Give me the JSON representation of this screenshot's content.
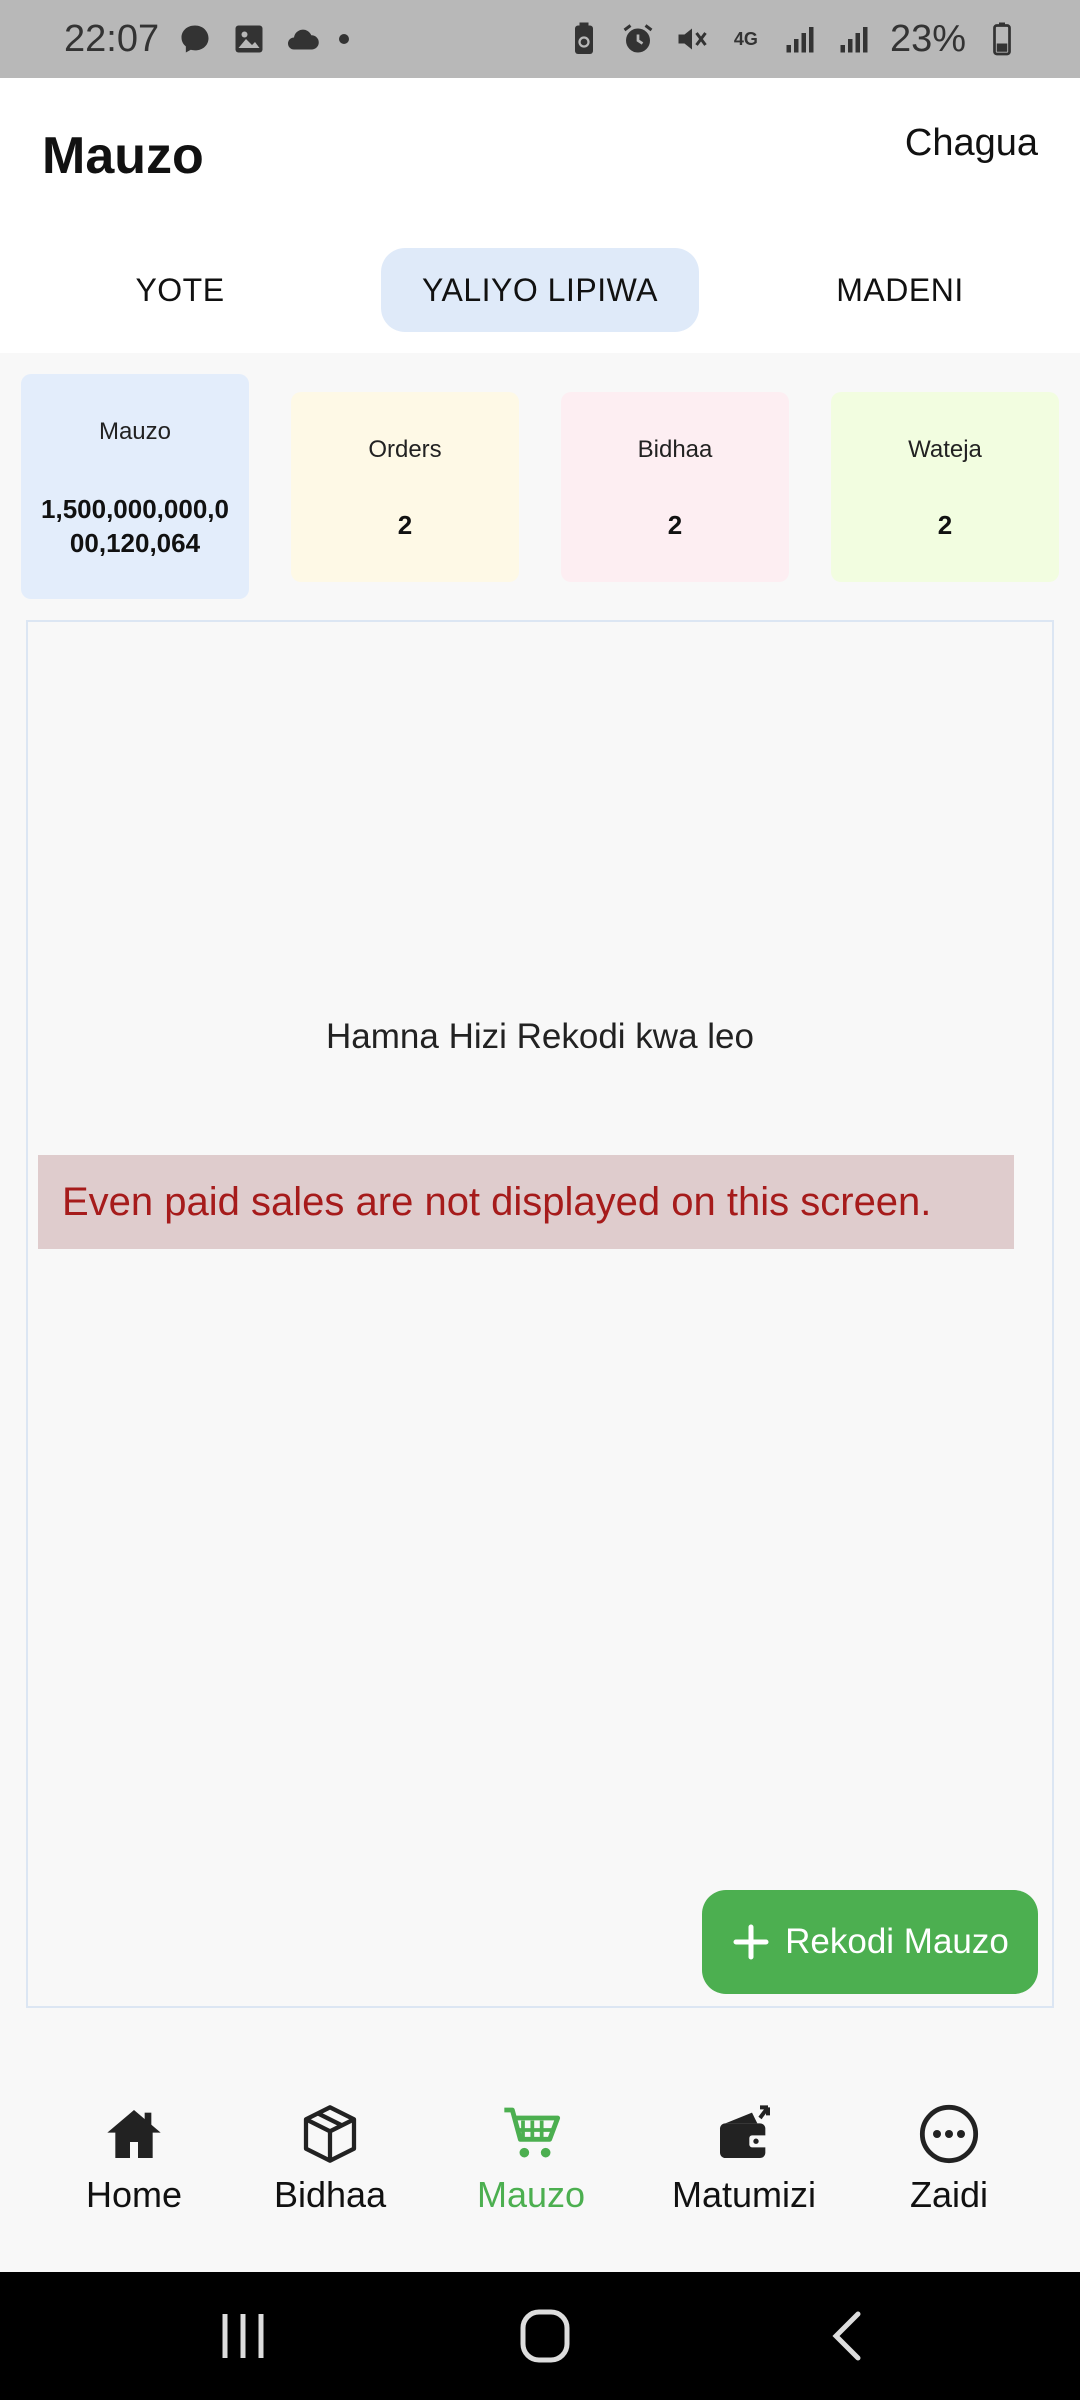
{
  "status_bar": {
    "time": "22:07",
    "battery": "23%",
    "network": "4G",
    "left_icons": [
      "messenger-icon",
      "gallery-icon",
      "cloud-icon",
      "dot-icon"
    ],
    "right_icons": [
      "battery-saver-icon",
      "alarm-icon",
      "mute-icon",
      "network-4g-icon",
      "signal-icon",
      "signal-icon",
      "battery-icon"
    ]
  },
  "header": {
    "title": "Mauzo",
    "select_label": "Chagua"
  },
  "tabs": [
    {
      "label": "YOTE",
      "active": false
    },
    {
      "label": "YALIYO LIPIWA",
      "active": true
    },
    {
      "label": "MADENI",
      "active": false
    }
  ],
  "cards": [
    {
      "label": "Mauzo",
      "value": "1,500,000,000,000,120,064",
      "color": "#e3edfb"
    },
    {
      "label": "Orders",
      "value": "2",
      "color": "#fef9e6"
    },
    {
      "label": "Bidhaa",
      "value": "2",
      "color": "#fdeef2"
    },
    {
      "label": "Wateja",
      "value": "2",
      "color": "#f2fde0"
    }
  ],
  "main": {
    "empty_text": "Hamna Hizi Rekodi kwa leo",
    "alert_text": "Even paid sales are not displayed on this screen.",
    "alert_color": "#a61b1b",
    "fab_label": "Rekodi Mauzo"
  },
  "nav": [
    {
      "label": "Home",
      "icon": "home-icon",
      "active": false
    },
    {
      "label": "Bidhaa",
      "icon": "box-icon",
      "active": false
    },
    {
      "label": "Mauzo",
      "icon": "cart-icon",
      "active": true
    },
    {
      "label": "Matumizi",
      "icon": "wallet-icon",
      "active": false
    },
    {
      "label": "Zaidi",
      "icon": "more-icon",
      "active": false
    }
  ],
  "colors": {
    "accent": "#4caf50",
    "active_tab": "#dfeaf9",
    "status_bar": "#b8b8b8"
  }
}
